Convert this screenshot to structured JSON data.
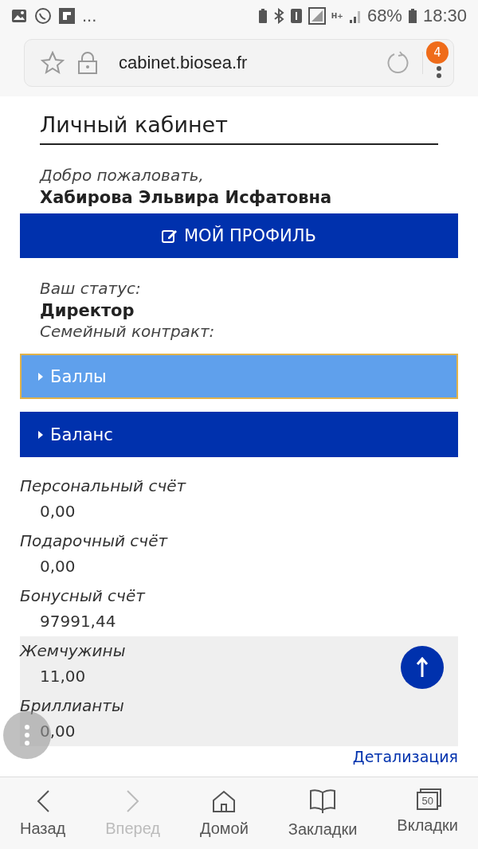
{
  "status_bar": {
    "more": "...",
    "network": "H+",
    "battery": "68%",
    "time": "18:30"
  },
  "browser": {
    "url": "cabinet.biosea.fr",
    "menu_badge": "4"
  },
  "page": {
    "title": "Личный кабинет",
    "welcome": "Добро пожаловать,",
    "user_name": "Хабирова Эльвира Исфатовна",
    "profile_button": "МОЙ ПРОФИЛЬ",
    "status_label": "Ваш статус:",
    "status_value": "Директор",
    "contract_label": "Семейный контракт:",
    "sections": [
      {
        "label": "Баллы",
        "selected": true
      },
      {
        "label": "Баланс",
        "selected": false
      }
    ],
    "accounts": [
      {
        "label": "Персональный счёт",
        "value": "0,00",
        "highlighted": false
      },
      {
        "label": "Подарочный счёт",
        "value": "0,00",
        "highlighted": false
      },
      {
        "label": "Бонусный счёт",
        "value": "97991,44",
        "highlighted": false
      },
      {
        "label": "Жемчужины",
        "value": "11,00",
        "highlighted": true
      },
      {
        "label": "Бриллианты",
        "value": "0,00",
        "highlighted": true
      }
    ],
    "details_link": "Детализация"
  },
  "bottom_nav": [
    {
      "label": "Назад",
      "kind": "back",
      "disabled": false
    },
    {
      "label": "Вперед",
      "kind": "forward",
      "disabled": true
    },
    {
      "label": "Домой",
      "kind": "home",
      "disabled": false
    },
    {
      "label": "Закладки",
      "kind": "bookmarks",
      "disabled": false
    },
    {
      "label": "Вкладки",
      "kind": "tabs",
      "disabled": false,
      "count": "50"
    }
  ]
}
